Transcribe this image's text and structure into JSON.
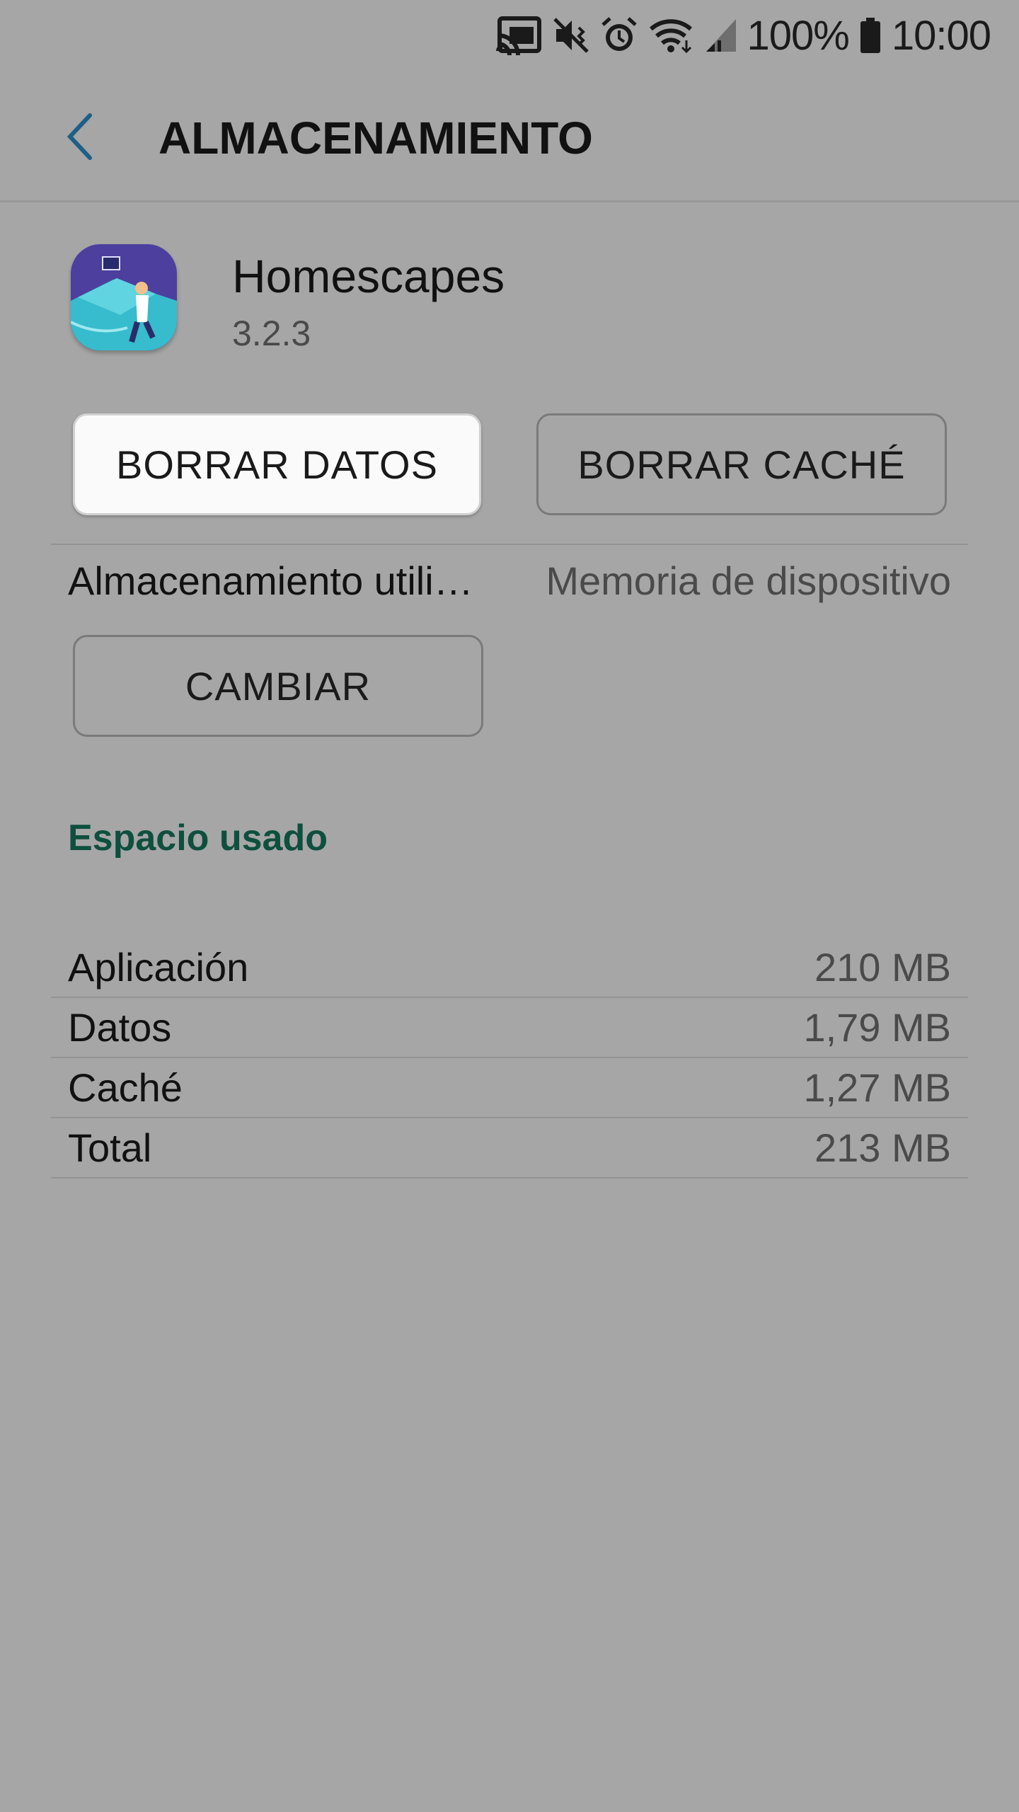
{
  "status_bar": {
    "icons": [
      "cast-icon",
      "mute-vibrate-icon",
      "alarm-icon",
      "wifi-icon",
      "signal-icon",
      "battery-icon"
    ],
    "battery": "100%",
    "time": "10:00"
  },
  "header": {
    "title": "ALMACENAMIENTO",
    "back_icon": "chevron-left-icon"
  },
  "app": {
    "name": "Homescapes",
    "version": "3.2.3",
    "icon": "homescapes-app-icon"
  },
  "actions": {
    "clear_data": "BORRAR DATOS",
    "clear_cache": "BORRAR CACHÉ",
    "change": "CAMBIAR"
  },
  "storage_used": {
    "label": "Almacenamiento utili…",
    "value": "Memoria de dispositivo"
  },
  "space_used": {
    "title": "Espacio usado",
    "rows": [
      {
        "label": "Aplicación",
        "value": "210 MB"
      },
      {
        "label": "Datos",
        "value": "1,79 MB"
      },
      {
        "label": "Caché",
        "value": "1,27 MB"
      },
      {
        "label": "Total",
        "value": "213 MB"
      }
    ]
  },
  "colors": {
    "background": "#a6a6a6",
    "accent_green": "#0e4f3e",
    "back_arrow": "#1d5f86"
  }
}
